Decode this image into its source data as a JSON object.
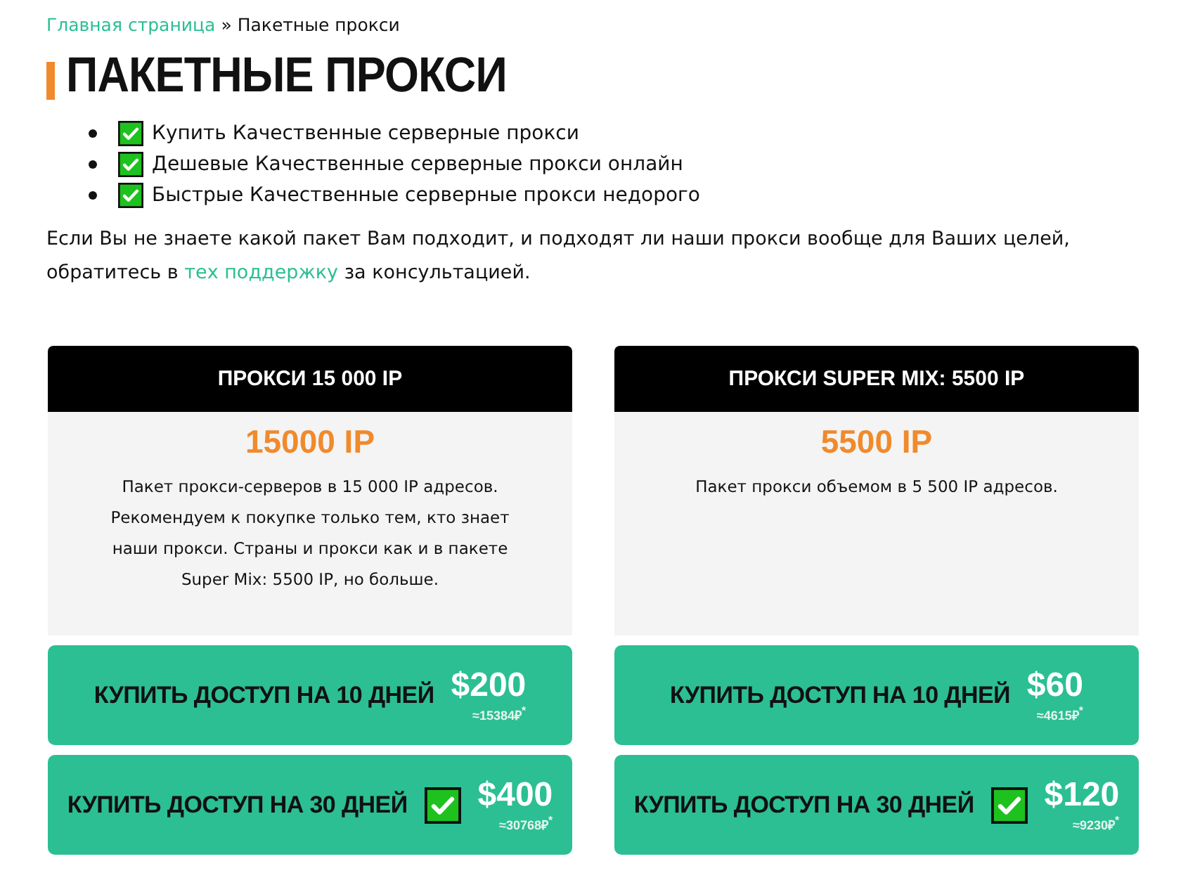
{
  "breadcrumb": {
    "link": "Главная страница",
    "separator": "»",
    "current": "Пакетные прокси"
  },
  "title": "ПАКЕТНЫЕ ПРОКСИ",
  "features": [
    {
      "text": "Купить Качественные серверные прокси",
      "checked": true
    },
    {
      "text": "Дешевые Качественные серверные прокси онлайн",
      "checked": true
    },
    {
      "text": "Быстрые Качественные серверные прокси недорого",
      "checked": true
    }
  ],
  "intro": {
    "before": "Если Вы не знаете какой пакет Вам подходит, и подходят ли наши прокси вообще для Ваших целей, обратитесь в",
    "link": "тех поддержку",
    "after": "за консультацией."
  },
  "packages": [
    {
      "name": "ПРОКСИ 15 000 IP",
      "amount": "15000 IP",
      "description": "Пакет прокси-серверов в 15 000 IP адресов. Рекомендуем к покупке только тем, кто знает наши прокси. Страны и прокси как и в пакете Super Mix: 5500 IP, но больше.",
      "options": [
        {
          "label": "КУПИТЬ ДОСТУП НА 10 ДНЕЙ",
          "recommended": false,
          "price": "$200",
          "rub": "≈15384₽$^{*}$"
        },
        {
          "label": "КУПИТЬ ДОСТУП НА 30 ДНЕЙ",
          "recommended": true,
          "price": "$400",
          "rub": "≈30768₽$^{*}$"
        }
      ]
    },
    {
      "name": "ПРОКСИ SUPER MIX: 5500 IP",
      "amount": "5500 IP",
      "description": "Пакет прокси объемом в 5 500 IP адресов.",
      "options": [
        {
          "label": "КУПИТЬ ДОСТУП НА 10 ДНЕЙ",
          "recommended": false,
          "price": "$60",
          "rub": "≈4615₽$^{*}$"
        },
        {
          "label": "КУПИТЬ ДОСТУП НА 30 ДНЕЙ",
          "recommended": true,
          "price": "$120",
          "rub": "≈9230₽$^{*}$"
        }
      ]
    }
  ]
}
